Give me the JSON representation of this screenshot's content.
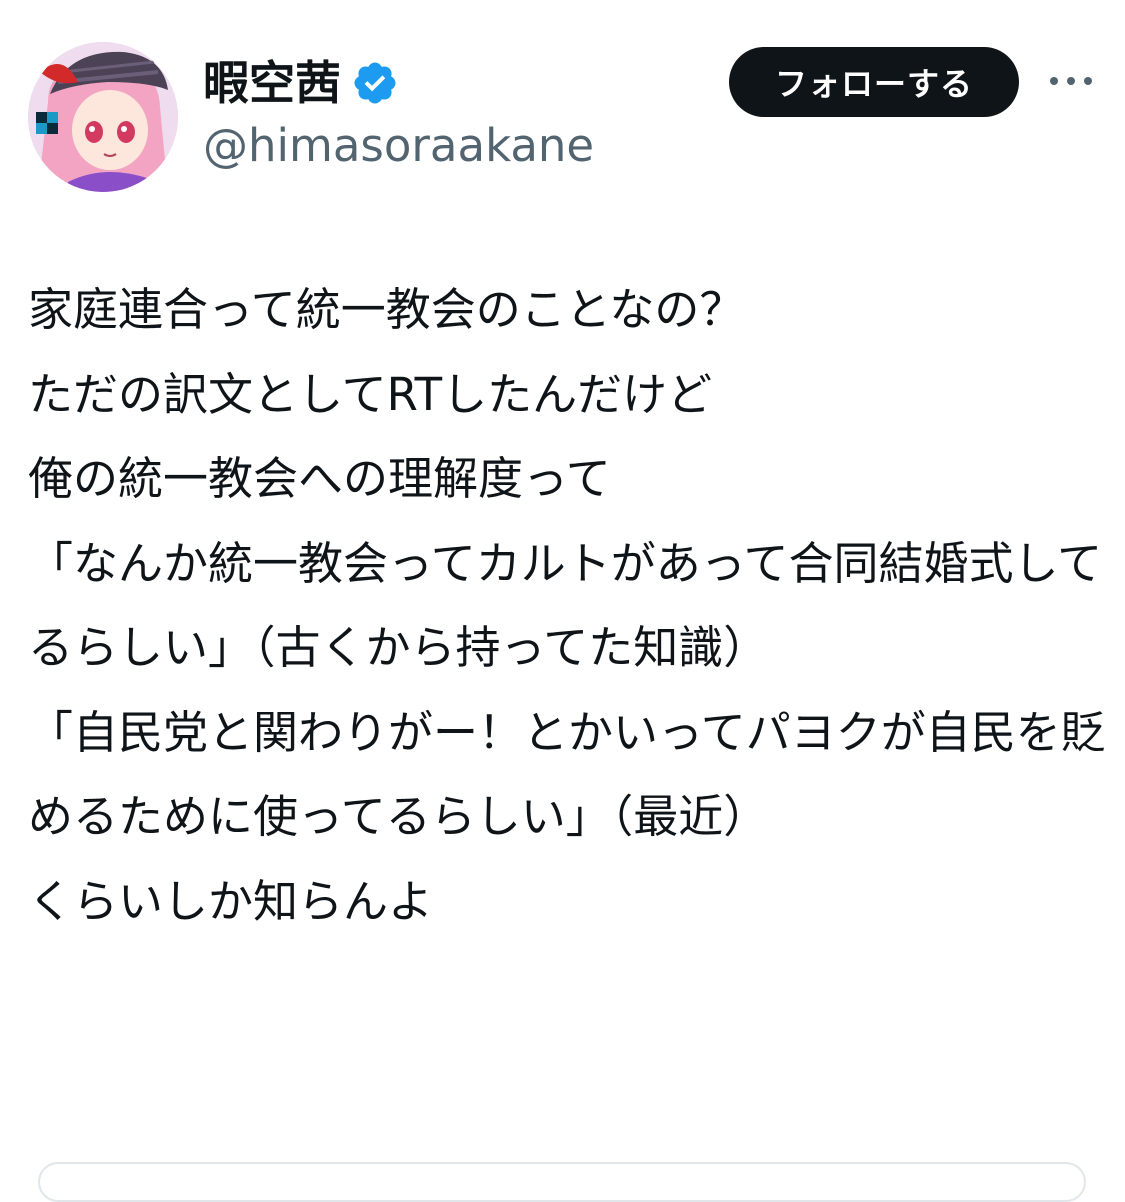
{
  "user": {
    "display_name": "暇空茜",
    "handle": "@himasoraakane",
    "verified_color": "#1d9bf0"
  },
  "actions": {
    "follow_label": "フォローする",
    "more_icon": "more-horizontal-icon"
  },
  "tweet": {
    "text": "家庭連合って統一教会のことなの？\nただの訳文としてRTしたんだけど\n俺の統一教会への理解度って\n「なんか統一教会ってカルトがあって合同結婚式してるらしい」（古くから持ってた知識）\n「自民党と関わりがー！とかいってパヨクが自民を貶めるために使ってるらしい」（最近）\nくらいしか知らんよ"
  },
  "colors": {
    "text_primary": "#0f1419",
    "text_secondary": "#536471",
    "button_bg": "#0f1419",
    "button_text": "#ffffff"
  }
}
